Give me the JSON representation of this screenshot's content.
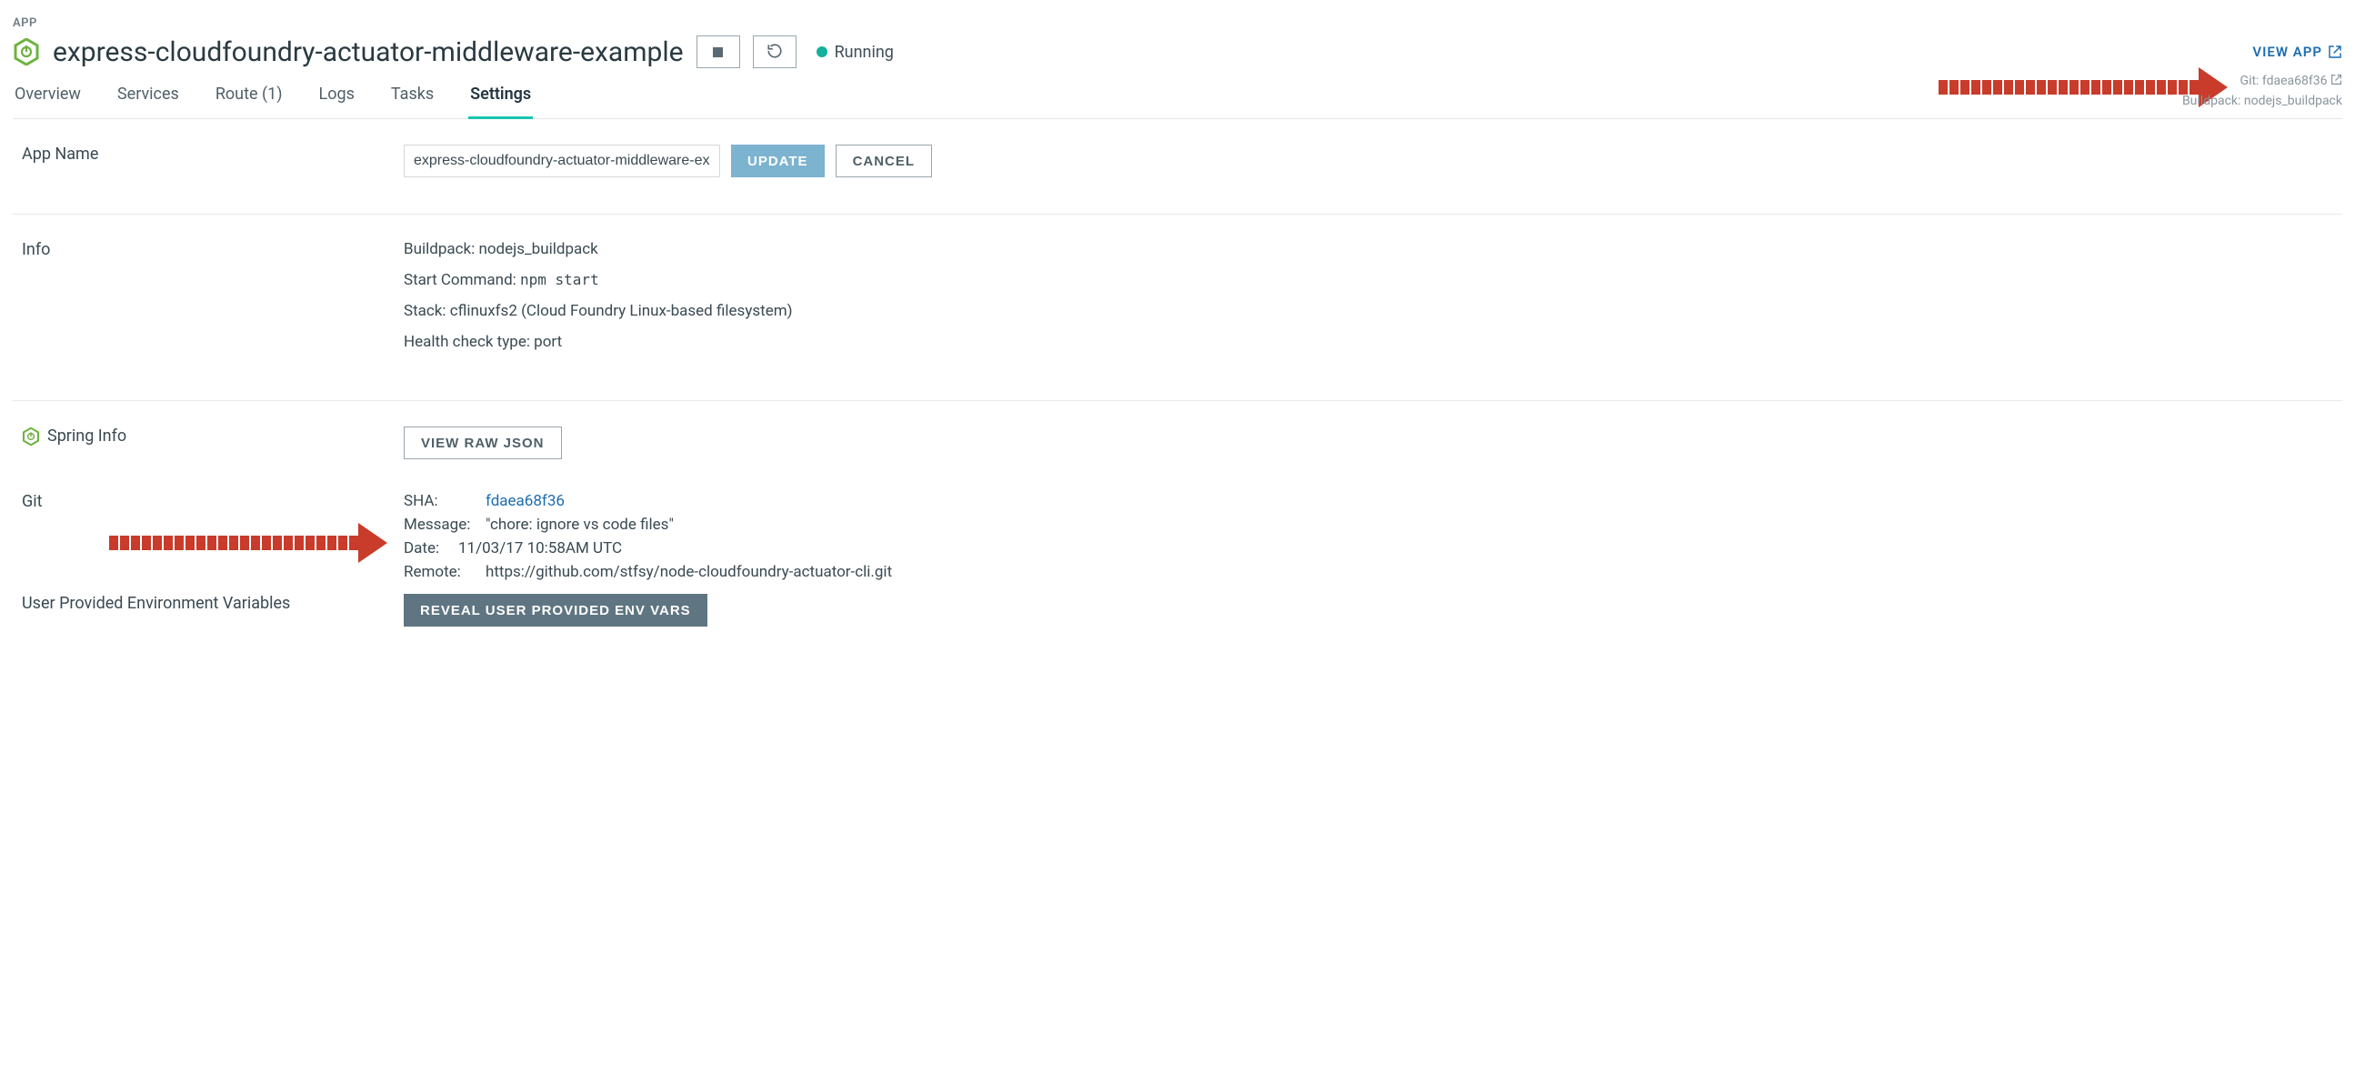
{
  "eyebrow": "APP",
  "header": {
    "title": "express-cloudfoundry-actuator-middleware-example",
    "status": "Running",
    "view_app": "VIEW APP"
  },
  "meta": {
    "git_prefix": "Git: ",
    "git_hash": "fdaea68f36",
    "buildpack_prefix": "Buildpack: ",
    "buildpack": "nodejs_buildpack"
  },
  "tabs": {
    "overview": "Overview",
    "services": "Services",
    "route": "Route (1)",
    "logs": "Logs",
    "tasks": "Tasks",
    "settings": "Settings"
  },
  "appname": {
    "label": "App Name",
    "value": "express-cloudfoundry-actuator-middleware-exa",
    "update": "UPDATE",
    "cancel": "CANCEL"
  },
  "info": {
    "label": "Info",
    "buildpack_label": "Buildpack: ",
    "buildpack": "nodejs_buildpack",
    "startcmd_label": "Start Command: ",
    "startcmd": "npm start",
    "stack_label": "Stack: ",
    "stack": "cflinuxfs2 (Cloud Foundry Linux-based filesystem)",
    "health_label": "Health check type: ",
    "health": "port"
  },
  "spring": {
    "label": "Spring Info",
    "button": "VIEW RAW JSON"
  },
  "git": {
    "label": "Git",
    "sha_k": "SHA:",
    "sha_v": "fdaea68f36",
    "msg_k": "Message:",
    "msg_v": "\"chore: ignore vs code files\"",
    "date_k": "Date:",
    "date_v": "11/03/17 10:58AM UTC",
    "remote_k": "Remote:",
    "remote_v": "https://github.com/stfsy/node-cloudfoundry-actuator-cli.git"
  },
  "env": {
    "label": "User Provided Environment Variables",
    "button": "REVEAL USER PROVIDED ENV VARS"
  }
}
